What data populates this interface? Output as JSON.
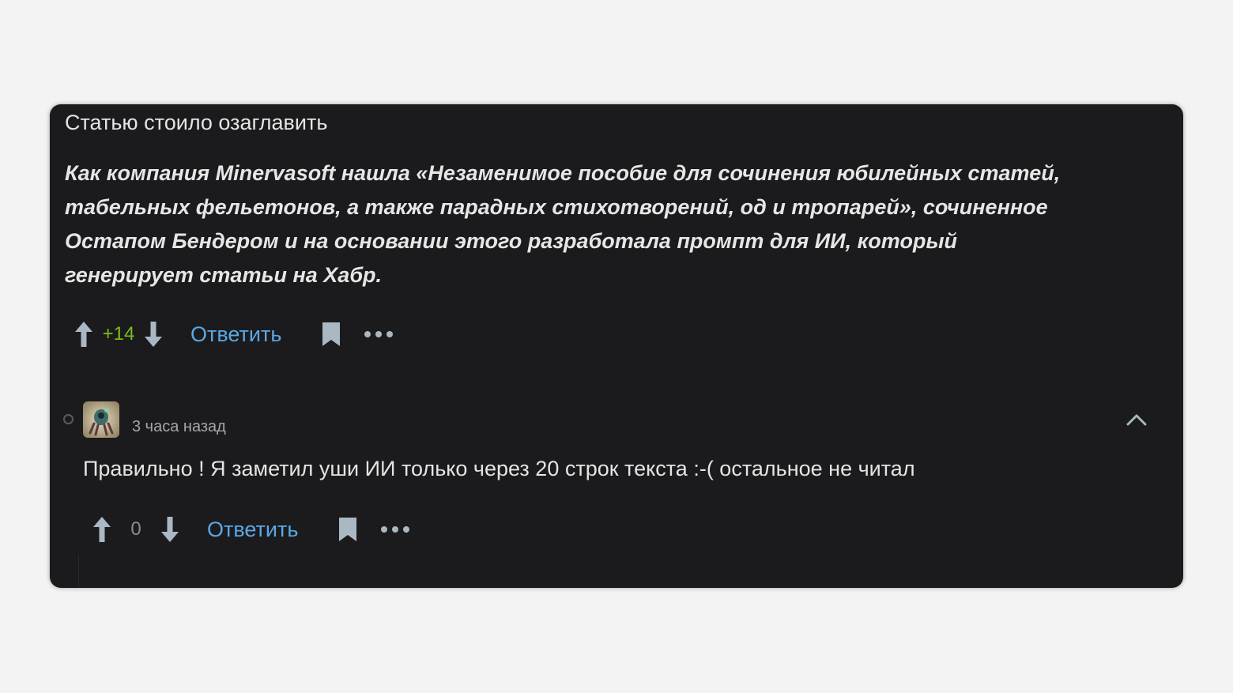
{
  "parent_comment": {
    "intro_text": "Статью стоило озаглавить",
    "quote_lines": [
      "Как компания Minervasoft нашла «Незаменимое пособие для сочинения юбилейных статей,",
      "табельных фельетонов, а также парадных стихотворений, од и тропарей», сочиненное",
      "Остапом Бендером и на основании этого разработала промпт для ИИ, который",
      "генерирует статьи на Хабр."
    ],
    "score": "+14",
    "reply_label": "Ответить"
  },
  "reply_comment": {
    "timestamp": "3 часа назад",
    "text": "Правильно ! Я заметил уши ИИ только через 20 строк текста :-( остальное не читал",
    "score": "0",
    "reply_label": "Ответить"
  },
  "icons": {
    "upvote": "arrow-up-icon",
    "downvote": "arrow-down-icon",
    "bookmark": "bookmark-icon",
    "more": "ellipsis-icon",
    "collapse": "chevron-up-icon"
  },
  "colors": {
    "page_background": "#f3f3f3",
    "card_background": "#1b1b1d",
    "text": "#e4e4e4",
    "score_positive": "#7cbd18",
    "score_neutral": "#8c8c8c",
    "link": "#5aa8e6",
    "icon": "#a9b8c3"
  }
}
